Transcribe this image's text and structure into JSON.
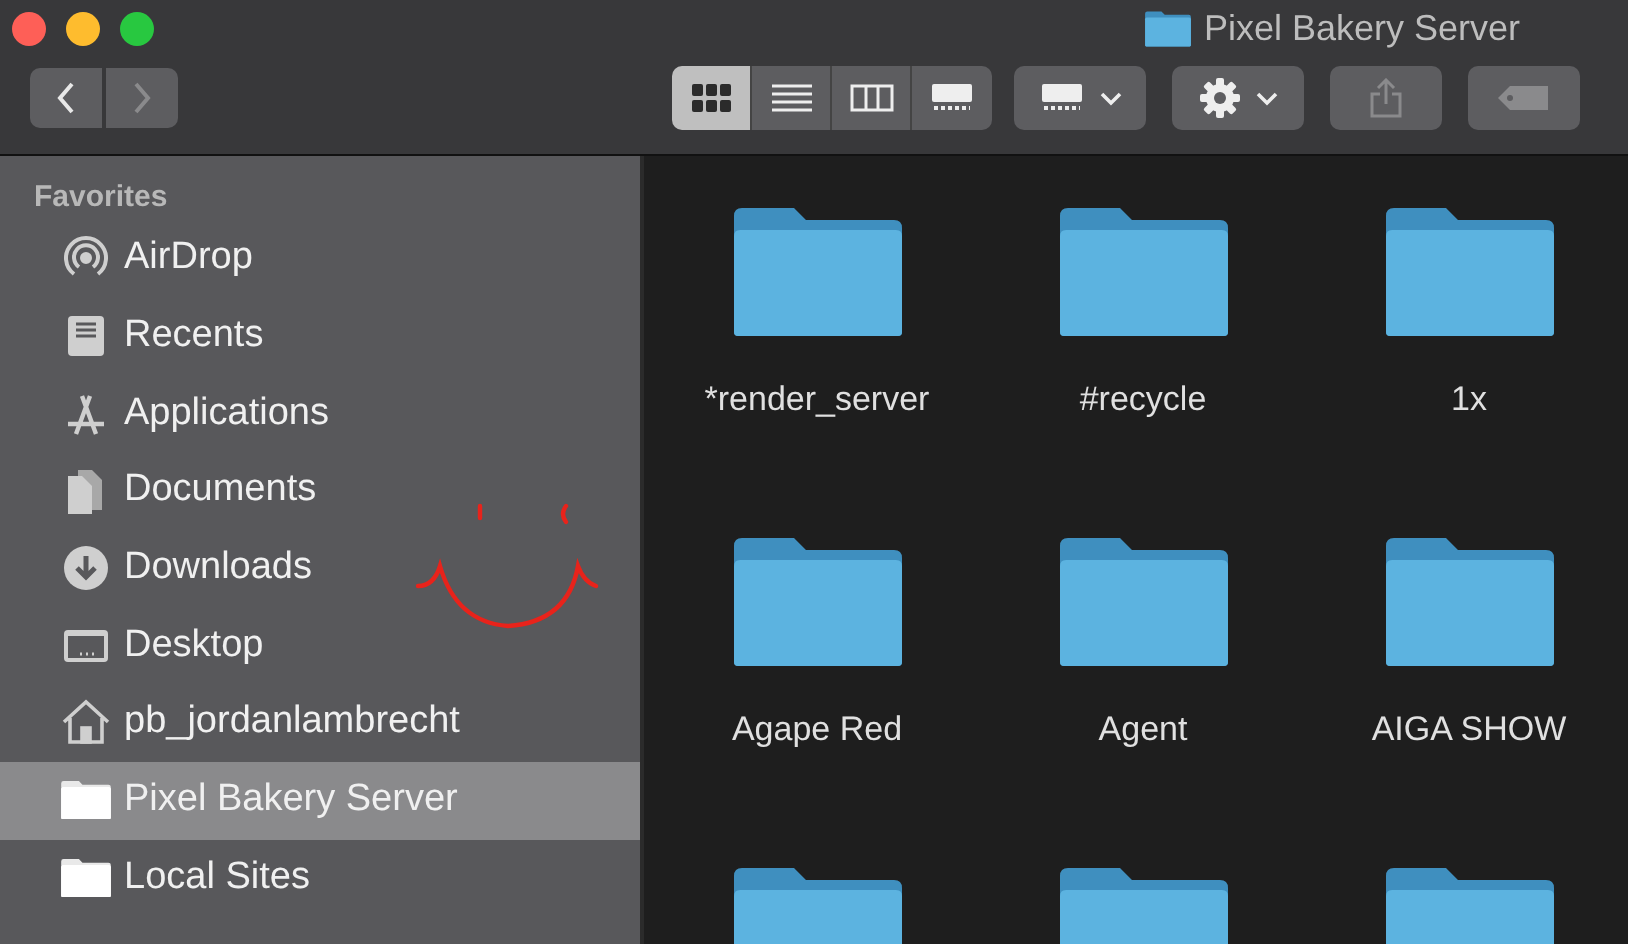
{
  "window": {
    "title": "Pixel Bakery Server"
  },
  "toolbar": {
    "back": {
      "disabled": false
    },
    "forward": {
      "disabled": true
    },
    "views": [
      {
        "kind": "icons",
        "selected": true
      },
      {
        "kind": "list",
        "selected": false
      },
      {
        "kind": "columns",
        "selected": false
      },
      {
        "kind": "gallery",
        "selected": false
      }
    ],
    "share": {
      "disabled": true
    },
    "tags": {
      "disabled": true
    }
  },
  "sidebar": {
    "heading": "Favorites",
    "items": [
      {
        "kind": "airdrop",
        "label": "AirDrop",
        "selected": false
      },
      {
        "kind": "recents",
        "label": "Recents",
        "selected": false
      },
      {
        "kind": "applications",
        "label": "Applications",
        "selected": false
      },
      {
        "kind": "documents",
        "label": "Documents",
        "selected": false
      },
      {
        "kind": "downloads",
        "label": "Downloads",
        "selected": false
      },
      {
        "kind": "desktop",
        "label": "Desktop",
        "selected": false
      },
      {
        "kind": "home",
        "label": "pb_jordanlambrecht",
        "selected": false
      },
      {
        "kind": "server",
        "label": "Pixel Bakery Server",
        "selected": true
      },
      {
        "kind": "folder",
        "label": "Local Sites",
        "selected": false
      }
    ]
  },
  "folders": [
    {
      "kind": "labeled",
      "name": "*render_server"
    },
    {
      "kind": "labeled",
      "name": "#recycle"
    },
    {
      "kind": "labeled",
      "name": "1x"
    },
    {
      "kind": "labeled",
      "name": "Agape Red"
    },
    {
      "kind": "labeled",
      "name": "Agent"
    },
    {
      "kind": "labeled",
      "name": "AIGA SHOW"
    },
    {
      "kind": "cut_off"
    },
    {
      "kind": "cut_off"
    },
    {
      "kind": "cut_off"
    }
  ]
}
